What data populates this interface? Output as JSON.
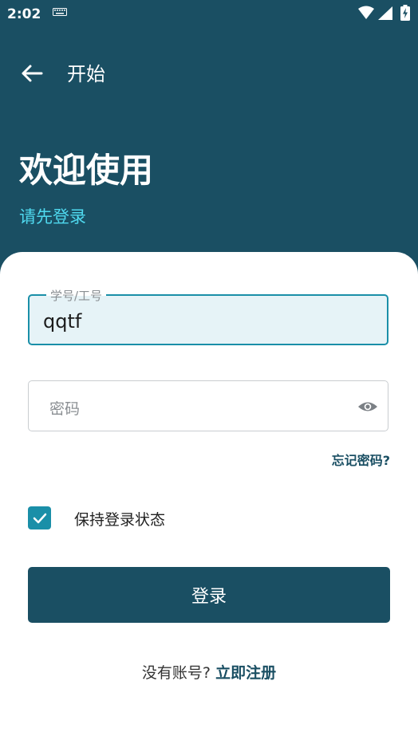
{
  "status_bar": {
    "time": "2:02",
    "icons": [
      "keyboard-icon",
      "wifi-icon",
      "signal-icon",
      "battery-charging-icon"
    ]
  },
  "app_bar": {
    "back_icon": "arrow-left-icon",
    "title": "开始"
  },
  "header": {
    "title": "欢迎使用",
    "subtitle": "请先登录"
  },
  "form": {
    "username": {
      "label": "学号/工号",
      "value": "qqtf"
    },
    "password": {
      "placeholder": "密码",
      "toggle_icon": "eye-icon"
    },
    "forgot_password": "忘记密码?",
    "remember_me": {
      "label": "保持登录状态",
      "checked": true
    },
    "login_button": "登录"
  },
  "footer": {
    "no_account_text": "没有账号?",
    "register_link": "立即注册"
  },
  "colors": {
    "primary": "#1a4f63",
    "accent": "#1a8fa8",
    "subtitle": "#4fd9ef",
    "input_fill": "#e6f3f7"
  }
}
